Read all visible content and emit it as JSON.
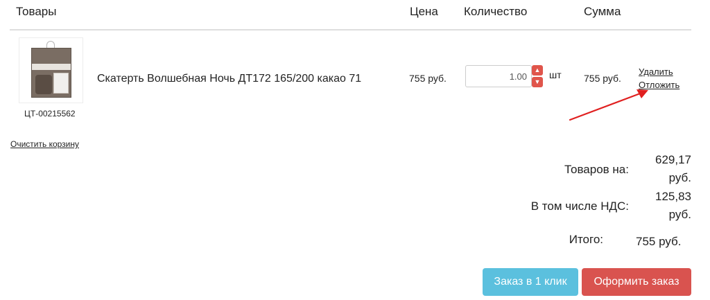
{
  "header": {
    "goods": "Товары",
    "price": "Цена",
    "quantity": "Количество",
    "sum": "Сумма"
  },
  "item": {
    "sku": "ЦТ-00215562",
    "name": "Скатерть Волшебная Ночь ДТ172 165/200 какао 71",
    "price": "755 руб.",
    "quantity": "1.00",
    "unit": "шт",
    "sum": "755 руб.",
    "delete_label": "Удалить",
    "defer_label": "Отложить"
  },
  "clear_cart": "Очистить корзину",
  "totals": {
    "goods_label": "Товаров на:",
    "goods_value": "629,17\nруб.",
    "vat_label": "В том числе НДС:",
    "vat_value": "125,83\nруб.",
    "total_label": "Итого:",
    "total_value": "755 руб."
  },
  "buttons": {
    "one_click": "Заказ в 1 клик",
    "checkout": "Оформить заказ"
  },
  "colors": {
    "accent_blue": "#5bc0de",
    "accent_red": "#d9534f",
    "arrow_red": "#e02020"
  },
  "icons": {
    "step_up": "chevron-up-icon",
    "step_down": "chevron-down-icon"
  }
}
